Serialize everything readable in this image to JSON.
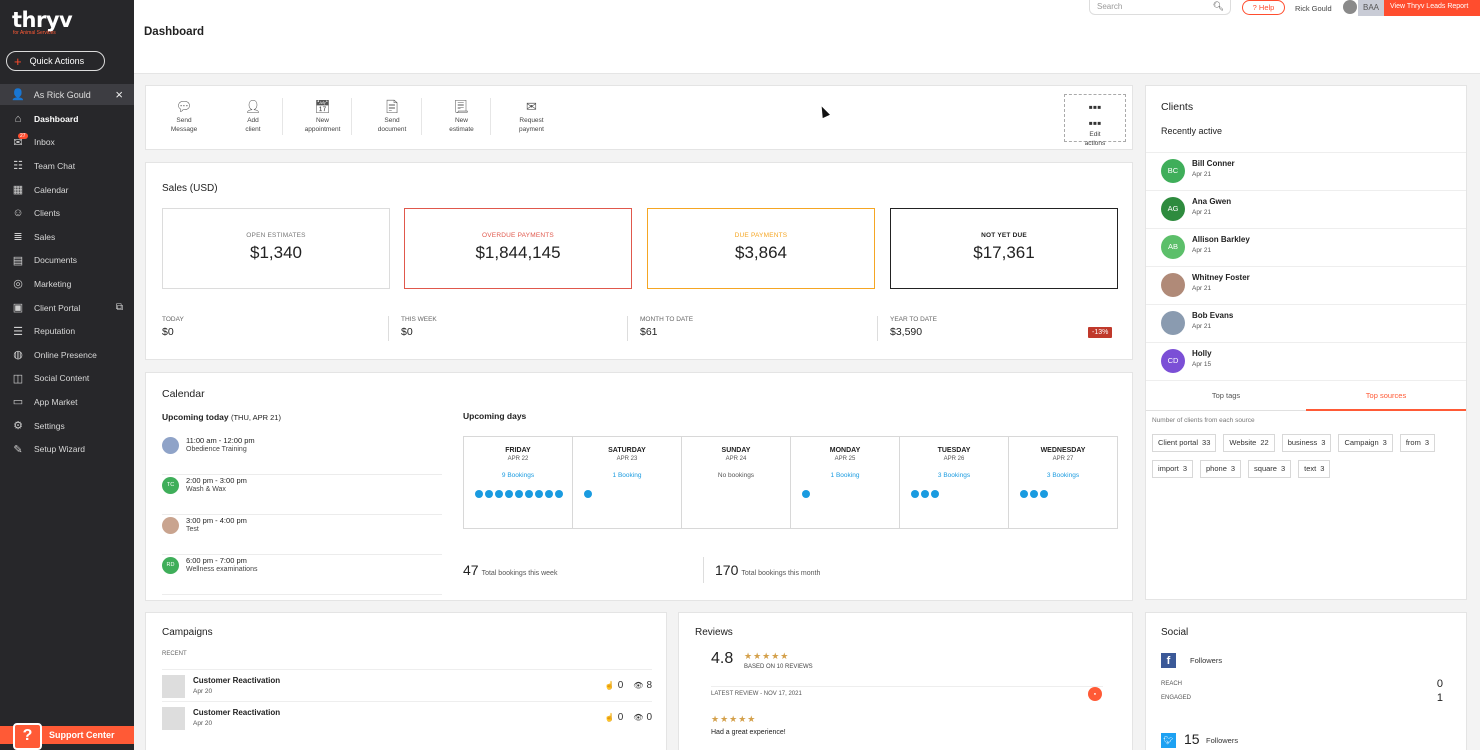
{
  "app": {
    "logo": "thryv",
    "logo_sub": "for Animal Services"
  },
  "sidebar": {
    "quick_actions": "Quick Actions",
    "as_user": "As Rick Gould",
    "items": [
      {
        "label": "Dashboard",
        "icon": "home-icon",
        "active": true
      },
      {
        "label": "Inbox",
        "icon": "inbox-icon",
        "badge": "27"
      },
      {
        "label": "Team Chat",
        "icon": "team-chat-icon"
      },
      {
        "label": "Calendar",
        "icon": "calendar-icon"
      },
      {
        "label": "Clients",
        "icon": "clients-icon"
      },
      {
        "label": "Sales",
        "icon": "sales-icon"
      },
      {
        "label": "Documents",
        "icon": "documents-icon"
      },
      {
        "label": "Marketing",
        "icon": "marketing-icon"
      },
      {
        "label": "Client Portal",
        "icon": "client-portal-icon",
        "external": true
      },
      {
        "label": "Reputation",
        "icon": "reputation-icon"
      },
      {
        "label": "Online Presence",
        "icon": "online-presence-icon"
      },
      {
        "label": "Social Content",
        "icon": "social-content-icon"
      },
      {
        "label": "App Market",
        "icon": "app-market-icon"
      },
      {
        "label": "Settings",
        "icon": "settings-icon"
      },
      {
        "label": "Setup Wizard",
        "icon": "setup-wizard-icon"
      }
    ],
    "support": "Support Center"
  },
  "header": {
    "title": "Dashboard",
    "search_placeholder": "Search",
    "help": "? Help",
    "user_name": "Rick Gould",
    "initials": "BAA",
    "leads_btn": "View Thryv Leads Report"
  },
  "quick_actions": {
    "items": [
      {
        "line1": "Send",
        "line2": "Message",
        "icon": "message-icon"
      },
      {
        "line1": "Add",
        "line2": "client",
        "icon": "add-client-icon"
      },
      {
        "line1": "New",
        "line2": "appointment",
        "icon": "appointment-icon"
      },
      {
        "line1": "Send",
        "line2": "document",
        "icon": "document-icon"
      },
      {
        "line1": "New",
        "line2": "estimate",
        "icon": "estimate-icon"
      },
      {
        "line1": "Request",
        "line2": "payment",
        "icon": "payment-icon"
      }
    ],
    "edit_line1": "Edit",
    "edit_line2": "actions"
  },
  "sales": {
    "title": "Sales (USD)",
    "metrics": [
      {
        "label": "OPEN ESTIMATES",
        "value": "$1,340"
      },
      {
        "label": "OVERDUE PAYMENTS",
        "value": "$1,844,145"
      },
      {
        "label": "DUE PAYMENTS",
        "value": "$3,864"
      },
      {
        "label": "NOT YET DUE",
        "value": "$17,361"
      }
    ],
    "stats": [
      {
        "label": "TODAY",
        "value": "$0"
      },
      {
        "label": "THIS WEEK",
        "value": "$0"
      },
      {
        "label": "MONTH TO DATE",
        "value": "$61"
      },
      {
        "label": "YEAR TO DATE",
        "value": "$3,590"
      }
    ],
    "ytd_change": "-13%"
  },
  "calendar": {
    "title": "Calendar",
    "today_label": "Upcoming today",
    "today_date": "(THU, APR 21)",
    "events": [
      {
        "time": "11:00 am - 12:00 pm",
        "desc": "Obedience Training",
        "initials": "",
        "color": "#8fa3c8"
      },
      {
        "time": "2:00 pm - 3:00 pm",
        "desc": "Wash & Wax",
        "initials": "TC",
        "color": "#3fae5a"
      },
      {
        "time": "3:00 pm - 4:00 pm",
        "desc": "Test",
        "initials": "",
        "color": "#c9a48f"
      },
      {
        "time": "6:00 pm - 7:00 pm",
        "desc": "Wellness examinations",
        "initials": "RD",
        "color": "#3fae5a"
      }
    ],
    "upcoming_label": "Upcoming days",
    "days": [
      {
        "name": "FRIDAY",
        "date": "APR 22",
        "bookings": "9 Bookings",
        "count": 9
      },
      {
        "name": "SATURDAY",
        "date": "APR 23",
        "bookings": "1 Booking",
        "count": 1
      },
      {
        "name": "SUNDAY",
        "date": "APR 24",
        "bookings": "No bookings",
        "count": 0
      },
      {
        "name": "MONDAY",
        "date": "APR 25",
        "bookings": "1 Booking",
        "count": 1
      },
      {
        "name": "TUESDAY",
        "date": "APR 26",
        "bookings": "3 Bookings",
        "count": 3
      },
      {
        "name": "WEDNESDAY",
        "date": "APR 27",
        "bookings": "3 Bookings",
        "count": 3
      }
    ],
    "week_total": "47",
    "week_label": "Total bookings this week",
    "month_total": "170",
    "month_label": "Total bookings this month"
  },
  "clients": {
    "title": "Clients",
    "recent_label": "Recently active",
    "list": [
      {
        "name": "Bill Conner",
        "date": "Apr 21",
        "initials": "BC",
        "color": "#3fae5a"
      },
      {
        "name": "Ana Gwen",
        "date": "Apr 21",
        "initials": "AG",
        "color": "#2e8b3e"
      },
      {
        "name": "Allison Barkley",
        "date": "Apr 21",
        "initials": "AB",
        "color": "#5cbf6a"
      },
      {
        "name": "Whitney Foster",
        "date": "Apr 21",
        "initials": "",
        "color": "#b08a78"
      },
      {
        "name": "Bob Evans",
        "date": "Apr 21",
        "initials": "",
        "color": "#8a9bb0"
      },
      {
        "name": "Holly",
        "date": "Apr 15",
        "initials": "CD",
        "color": "#7b4fd6"
      }
    ],
    "tabs": [
      "Top tags",
      "Top sources"
    ],
    "sources_desc": "Number of clients from each source",
    "sources": [
      {
        "name": "Client portal",
        "count": "33"
      },
      {
        "name": "Website",
        "count": "22"
      },
      {
        "name": "business",
        "count": "3"
      },
      {
        "name": "Campaign",
        "count": "3"
      },
      {
        "name": "from",
        "count": "3"
      },
      {
        "name": "import",
        "count": "3"
      },
      {
        "name": "phone",
        "count": "3"
      },
      {
        "name": "square",
        "count": "3"
      },
      {
        "name": "text",
        "count": "3"
      }
    ]
  },
  "campaigns": {
    "title": "Campaigns",
    "recent": "RECENT",
    "items": [
      {
        "name": "Customer Reactivation",
        "date": "Apr 20",
        "clicks": "0",
        "views": "8"
      },
      {
        "name": "Customer Reactivation",
        "date": "Apr 20",
        "clicks": "0",
        "views": "0"
      }
    ]
  },
  "reviews": {
    "title": "Reviews",
    "rating": "4.8",
    "stars": "★★★★★",
    "based_on": "BASED ON 10 REVIEWS",
    "latest": "LATEST REVIEW - NOV 17, 2021",
    "latest_stars": "★★★★★",
    "latest_text": "Had a great experience!"
  },
  "social": {
    "title": "Social",
    "fb_label": "Followers",
    "reach_label": "REACH",
    "reach": "0",
    "engaged_label": "ENGAGED",
    "engaged": "1",
    "tw_followers": "15",
    "tw_label": "Followers"
  }
}
